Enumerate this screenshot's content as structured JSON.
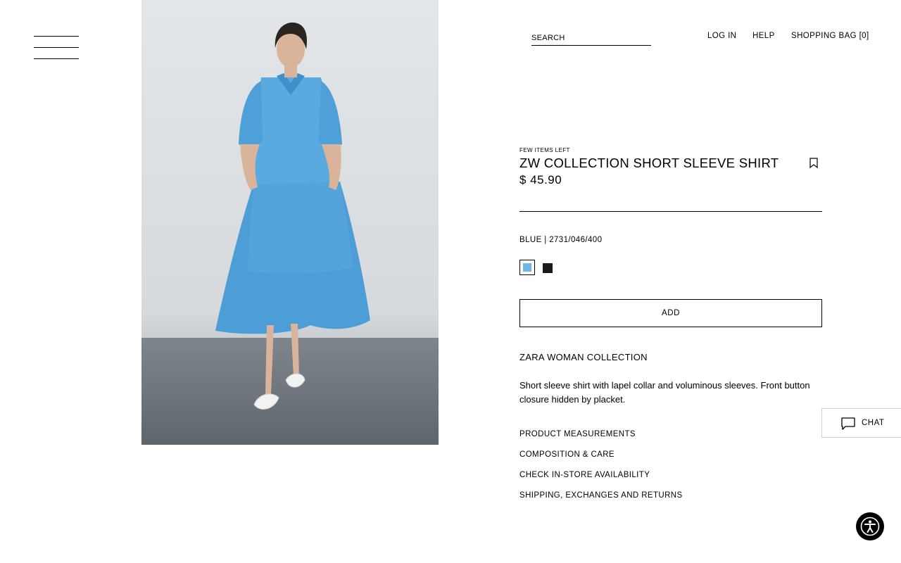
{
  "header": {
    "menu_icon": "hamburger-menu-icon",
    "search_placeholder": "SEARCH",
    "login_label": "LOG IN",
    "help_label": "HELP",
    "bag_label": "SHOPPING BAG [0]"
  },
  "product": {
    "stock_notice": "FEW ITEMS LEFT",
    "title": "ZW COLLECTION SHORT SLEEVE SHIRT",
    "price": "$ 45.90",
    "bookmark_icon": "bookmark-icon",
    "color_ref": "BLUE | 2731/046/400",
    "swatches": [
      {
        "name": "blue",
        "color": "#6db8ea",
        "selected": true
      },
      {
        "name": "black",
        "color": "#1a1a1a",
        "selected": false
      }
    ],
    "add_label": "ADD",
    "collection": "ZARA WOMAN COLLECTION",
    "description": "Short sleeve shirt with lapel collar and voluminous sleeves. Front button closure hidden by placket.",
    "links": {
      "measurements": "PRODUCT MEASUREMENTS",
      "composition": "COMPOSITION & CARE",
      "availability": "CHECK IN-STORE AVAILABILITY",
      "shipping": "SHIPPING, EXCHANGES AND RETURNS"
    }
  },
  "chat": {
    "icon": "chat-bubble-icon",
    "label": "CHAT"
  },
  "accessibility": {
    "icon": "accessibility-icon"
  },
  "colors": {
    "garment_blue": "#4d9ed6",
    "text": "#000000",
    "background": "#ffffff"
  }
}
